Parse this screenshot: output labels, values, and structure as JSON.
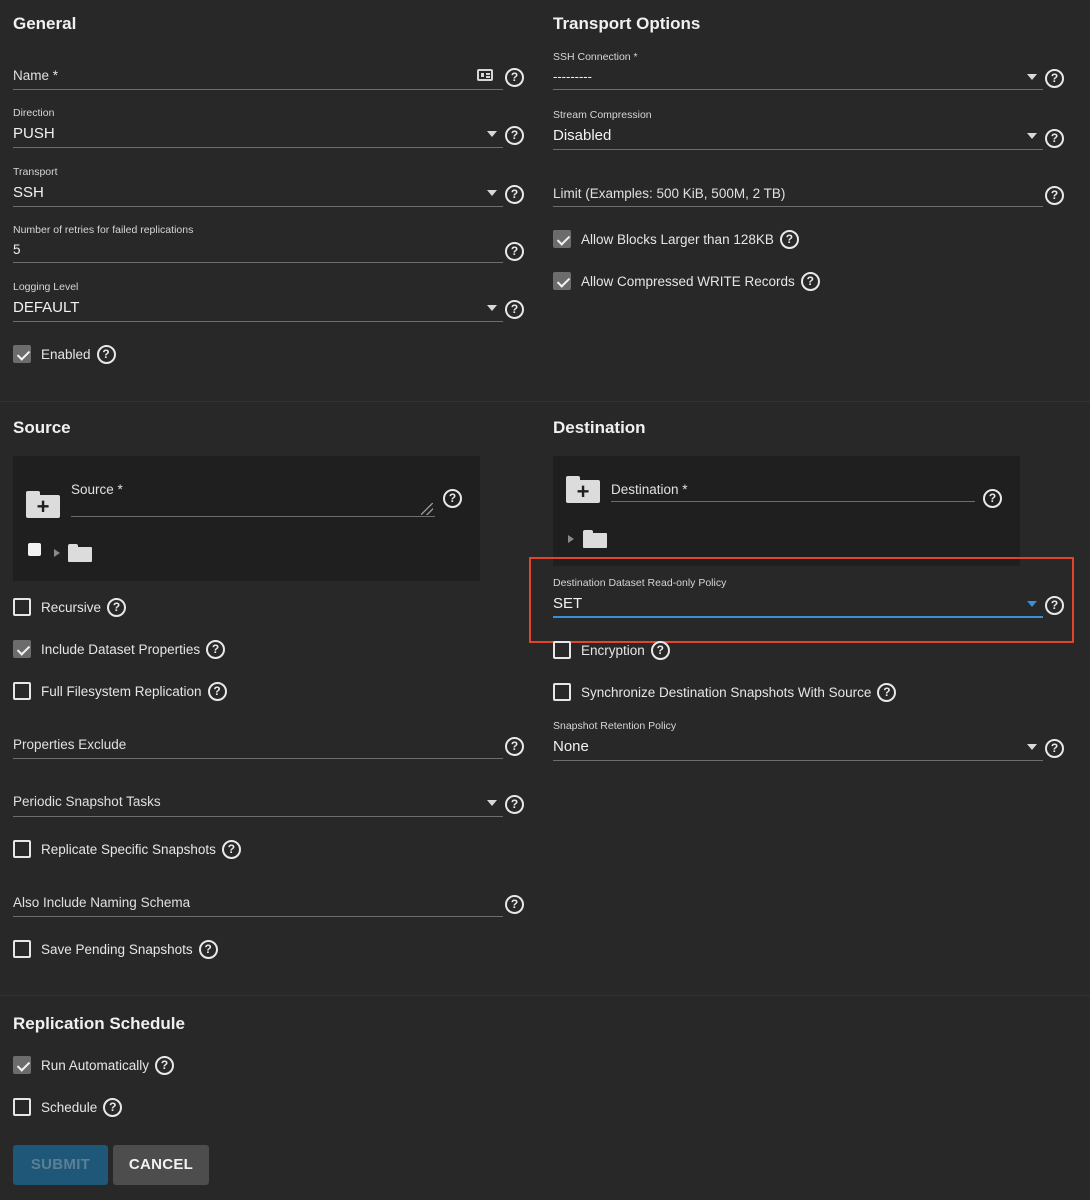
{
  "general": {
    "title": "General",
    "name": {
      "label": "Name *",
      "value": ""
    },
    "direction": {
      "label": "Direction",
      "value": "PUSH"
    },
    "transport": {
      "label": "Transport",
      "value": "SSH"
    },
    "retries": {
      "label": "Number of retries for failed replications",
      "value": "5"
    },
    "logging": {
      "label": "Logging Level",
      "value": "DEFAULT"
    },
    "enabled": {
      "label": "Enabled",
      "checked": true
    }
  },
  "transport_options": {
    "title": "Transport Options",
    "ssh_connection": {
      "label": "SSH Connection *",
      "value": "---------"
    },
    "stream_compression": {
      "label": "Stream Compression",
      "value": "Disabled"
    },
    "limit": {
      "label": "Limit (Examples: 500 KiB, 500M, 2 TB)",
      "value": ""
    },
    "allow_large_blocks": {
      "label": "Allow Blocks Larger than 128KB",
      "checked": true
    },
    "allow_compressed": {
      "label": "Allow Compressed WRITE Records",
      "checked": true
    }
  },
  "source": {
    "title": "Source",
    "source_field": {
      "label": "Source *",
      "value": ""
    },
    "recursive": {
      "label": "Recursive",
      "checked": false
    },
    "include_props": {
      "label": "Include Dataset Properties",
      "checked": true
    },
    "full_fs": {
      "label": "Full Filesystem Replication",
      "checked": false
    },
    "props_exclude": {
      "label": "Properties Exclude",
      "value": ""
    },
    "periodic_tasks": {
      "label": "Periodic Snapshot Tasks",
      "value": ""
    },
    "replicate_specific": {
      "label": "Replicate Specific Snapshots",
      "checked": false
    },
    "naming_schema": {
      "label": "Also Include Naming Schema",
      "value": ""
    },
    "save_pending": {
      "label": "Save Pending Snapshots",
      "checked": false
    }
  },
  "destination": {
    "title": "Destination",
    "dest_field": {
      "label": "Destination *",
      "value": ""
    },
    "readonly_policy": {
      "label": "Destination Dataset Read-only Policy",
      "value": "SET"
    },
    "encryption": {
      "label": "Encryption",
      "checked": false
    },
    "sync_snapshots": {
      "label": "Synchronize Destination Snapshots With Source",
      "checked": false
    },
    "retention": {
      "label": "Snapshot Retention Policy",
      "value": "None"
    }
  },
  "schedule": {
    "title": "Replication Schedule",
    "run_auto": {
      "label": "Run Automatically",
      "checked": true
    },
    "schedule": {
      "label": "Schedule",
      "checked": false
    }
  },
  "actions": {
    "submit": "SUBMIT",
    "cancel": "CANCEL"
  },
  "help_glyph": "?",
  "colors": {
    "highlight": "#e2452c",
    "focus": "#3a8fd6",
    "background": "#282828"
  }
}
